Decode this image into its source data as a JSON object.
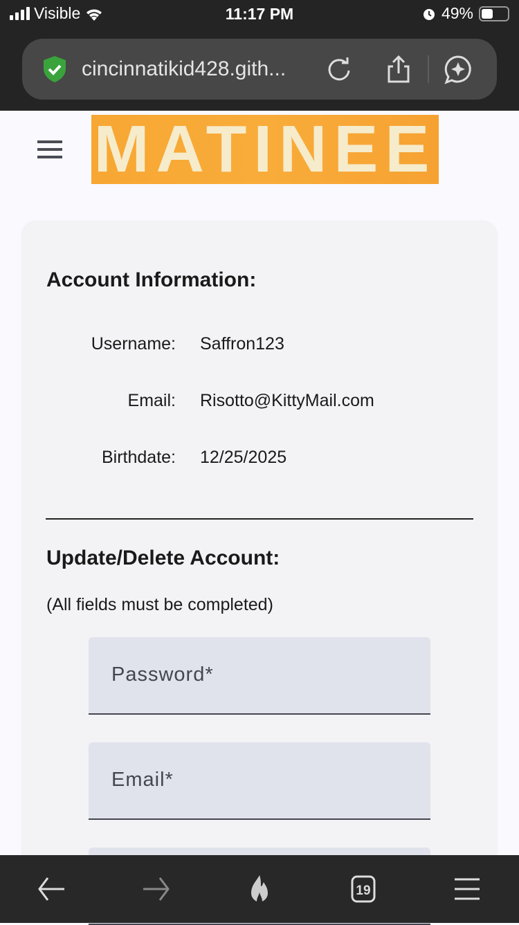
{
  "status_bar": {
    "carrier": "Visible",
    "time": "11:17 PM",
    "battery": "49%",
    "battery_level": 0.49
  },
  "browser": {
    "url": "cincinnatikid428.gith...",
    "tab_count": "19"
  },
  "header": {
    "logo_text": "MATINEE"
  },
  "account": {
    "title": "Account Information:",
    "fields": [
      {
        "label": "Username:",
        "value": "Saffron123"
      },
      {
        "label": "Email:",
        "value": "Risotto@KittyMail.com"
      },
      {
        "label": "Birthdate:",
        "value": "12/25/2025"
      }
    ]
  },
  "update": {
    "title": "Update/Delete Account:",
    "note": "(All fields must be completed)",
    "password_placeholder": "Password*",
    "email_placeholder": "Email*"
  }
}
